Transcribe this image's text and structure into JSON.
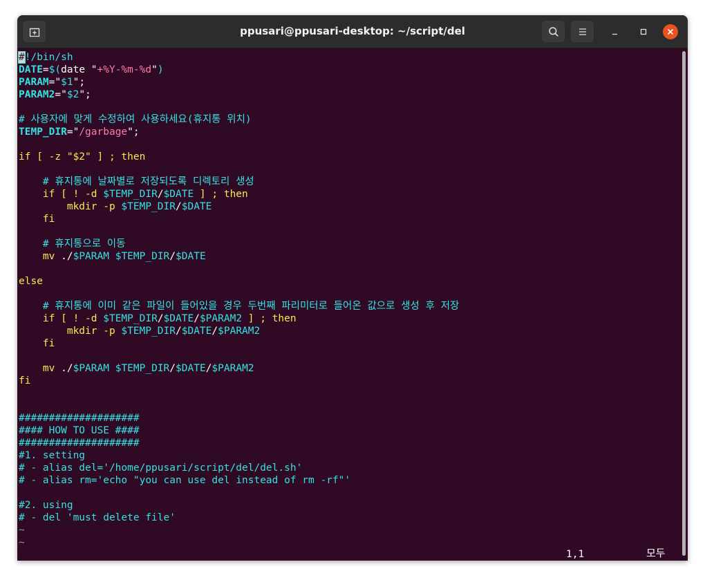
{
  "window": {
    "title": "ppusari@ppusari-desktop: ~/script/del"
  },
  "icons": {
    "new_tab": "new-tab-icon",
    "search": "search-icon",
    "menu": "hamburger-menu-icon",
    "minimize": "minimize-icon",
    "maximize": "maximize-icon",
    "close": "close-icon"
  },
  "colors": {
    "terminal_background": "#300a24",
    "titlebar_background": "#2c2c2c",
    "comment": "#34e2e2",
    "keyword": "#fce94f",
    "string": "#ff7aa8",
    "close_button": "#e95420"
  },
  "editor": {
    "lines": [
      [
        {
          "t": "#",
          "c": "cursor"
        },
        {
          "t": "!/bin/sh",
          "c": "c-comment"
        }
      ],
      [
        {
          "t": "DATE",
          "c": "c-var"
        },
        {
          "t": "=",
          "c": ""
        },
        {
          "t": "$(",
          "c": "c-expand"
        },
        {
          "t": "date ",
          "c": ""
        },
        {
          "t": "\"",
          "c": ""
        },
        {
          "t": "+%Y-%m-%d",
          "c": "c-str"
        },
        {
          "t": "\"",
          "c": ""
        },
        {
          "t": ")",
          "c": "c-expand"
        }
      ],
      [
        {
          "t": "PARAM",
          "c": "c-var"
        },
        {
          "t": "=\"",
          "c": ""
        },
        {
          "t": "$1",
          "c": "c-expand"
        },
        {
          "t": "\";",
          "c": ""
        }
      ],
      [
        {
          "t": "PARAM2",
          "c": "c-var"
        },
        {
          "t": "=\"",
          "c": ""
        },
        {
          "t": "$2",
          "c": "c-expand"
        },
        {
          "t": "\";",
          "c": ""
        }
      ],
      [],
      [
        {
          "t": "# 사용자에 맞게 수정하여 사용하세요(휴지통 위치)",
          "c": "c-comment"
        }
      ],
      [
        {
          "t": "TEMP_DIR",
          "c": "c-var"
        },
        {
          "t": "=\"",
          "c": ""
        },
        {
          "t": "/garbage",
          "c": "c-str"
        },
        {
          "t": "\";",
          "c": ""
        }
      ],
      [],
      [
        {
          "t": "if [ -z \"$2\" ] ; then",
          "c": "c-kw"
        }
      ],
      [],
      [
        {
          "t": "    ",
          "c": ""
        },
        {
          "t": "# 휴지통에 날짜별로 저장되도록 디렉토리 생성",
          "c": "c-comment"
        }
      ],
      [
        {
          "t": "    ",
          "c": ""
        },
        {
          "t": "if [ ! -d ",
          "c": "c-kw"
        },
        {
          "t": "$TEMP_DIR",
          "c": "c-expand"
        },
        {
          "t": "/",
          "c": ""
        },
        {
          "t": "$DATE",
          "c": "c-expand"
        },
        {
          "t": " ] ; then",
          "c": "c-kw"
        }
      ],
      [
        {
          "t": "        ",
          "c": ""
        },
        {
          "t": "mkdir -p ",
          "c": "c-kw"
        },
        {
          "t": "$TEMP_DIR",
          "c": "c-expand"
        },
        {
          "t": "/",
          "c": ""
        },
        {
          "t": "$DATE",
          "c": "c-expand"
        }
      ],
      [
        {
          "t": "    ",
          "c": ""
        },
        {
          "t": "fi",
          "c": "c-kw"
        }
      ],
      [],
      [
        {
          "t": "    ",
          "c": ""
        },
        {
          "t": "# 휴지통으로 이동",
          "c": "c-comment"
        }
      ],
      [
        {
          "t": "    ",
          "c": ""
        },
        {
          "t": "mv ",
          "c": "c-kw"
        },
        {
          "t": "./",
          "c": ""
        },
        {
          "t": "$PARAM",
          "c": "c-expand"
        },
        {
          "t": " ",
          "c": ""
        },
        {
          "t": "$TEMP_DIR",
          "c": "c-expand"
        },
        {
          "t": "/",
          "c": ""
        },
        {
          "t": "$DATE",
          "c": "c-expand"
        }
      ],
      [],
      [
        {
          "t": "else",
          "c": "c-kw"
        }
      ],
      [],
      [
        {
          "t": "    ",
          "c": ""
        },
        {
          "t": "# 휴지통에 이미 같은 파일이 들어있을 경우 두번째 파리미터로 들어온 값으로 생성 후 저장",
          "c": "c-comment"
        }
      ],
      [
        {
          "t": "    ",
          "c": ""
        },
        {
          "t": "if [ ! -d ",
          "c": "c-kw"
        },
        {
          "t": "$TEMP_DIR",
          "c": "c-expand"
        },
        {
          "t": "/",
          "c": ""
        },
        {
          "t": "$DATE",
          "c": "c-expand"
        },
        {
          "t": "/",
          "c": ""
        },
        {
          "t": "$PARAM2",
          "c": "c-expand"
        },
        {
          "t": " ] ; then",
          "c": "c-kw"
        }
      ],
      [
        {
          "t": "        ",
          "c": ""
        },
        {
          "t": "mkdir -p ",
          "c": "c-kw"
        },
        {
          "t": "$TEMP_DIR",
          "c": "c-expand"
        },
        {
          "t": "/",
          "c": ""
        },
        {
          "t": "$DATE",
          "c": "c-expand"
        },
        {
          "t": "/",
          "c": ""
        },
        {
          "t": "$PARAM2",
          "c": "c-expand"
        }
      ],
      [
        {
          "t": "    ",
          "c": ""
        },
        {
          "t": "fi",
          "c": "c-kw"
        }
      ],
      [],
      [
        {
          "t": "    ",
          "c": ""
        },
        {
          "t": "mv ",
          "c": "c-kw"
        },
        {
          "t": "./",
          "c": ""
        },
        {
          "t": "$PARAM",
          "c": "c-expand"
        },
        {
          "t": " ",
          "c": ""
        },
        {
          "t": "$TEMP_DIR",
          "c": "c-expand"
        },
        {
          "t": "/",
          "c": ""
        },
        {
          "t": "$DATE",
          "c": "c-expand"
        },
        {
          "t": "/",
          "c": ""
        },
        {
          "t": "$PARAM2",
          "c": "c-expand"
        }
      ],
      [
        {
          "t": "fi",
          "c": "c-kw"
        }
      ],
      [],
      [],
      [
        {
          "t": "####################",
          "c": "c-comment"
        }
      ],
      [
        {
          "t": "#### HOW TO USE ####",
          "c": "c-comment"
        }
      ],
      [
        {
          "t": "####################",
          "c": "c-comment"
        }
      ],
      [
        {
          "t": "#1. setting",
          "c": "c-comment"
        }
      ],
      [
        {
          "t": "# - alias del='/home/ppusari/script/del/del.sh'",
          "c": "c-comment"
        }
      ],
      [
        {
          "t": "# - alias rm='echo \"you can use del instead of rm -rf\"'",
          "c": "c-comment"
        }
      ],
      [],
      [
        {
          "t": "#2. using",
          "c": "c-comment"
        }
      ],
      [
        {
          "t": "# - del 'must delete file'",
          "c": "c-comment"
        }
      ],
      [
        {
          "t": "~",
          "c": "c-tilde"
        }
      ],
      [
        {
          "t": "~",
          "c": "c-tilde"
        }
      ]
    ]
  },
  "statusbar": {
    "cursor_position": "1,1",
    "scroll_indicator": "모두"
  }
}
